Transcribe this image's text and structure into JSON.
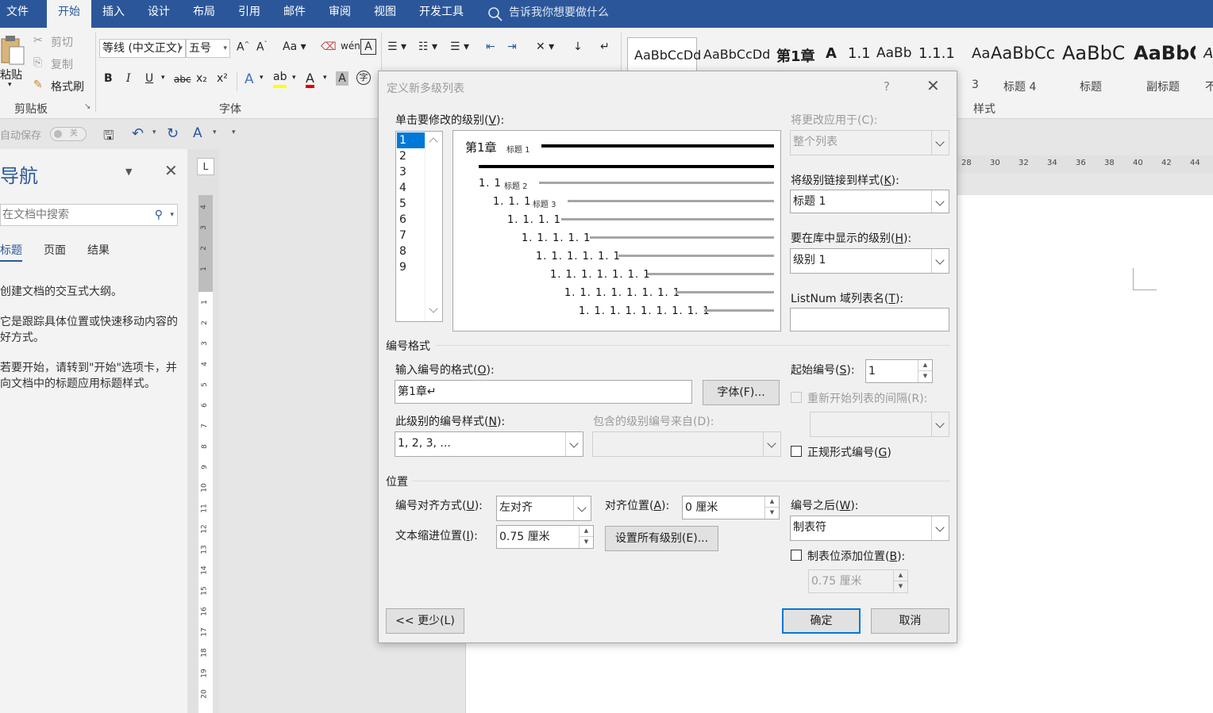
{
  "menubar": {
    "tabs": [
      "文件",
      "开始",
      "插入",
      "设计",
      "布局",
      "引用",
      "邮件",
      "审阅",
      "视图",
      "开发工具"
    ],
    "active": "开始",
    "tell_me": "告诉我你想要做什么"
  },
  "ribbon": {
    "clipboard": {
      "paste": "粘贴",
      "cut": "剪切",
      "copy": "复制",
      "format_painter": "格式刷",
      "group_label": "剪贴板"
    },
    "font": {
      "font_name": "等线 (中文正文)",
      "font_size": "五号",
      "group_label": "字体",
      "bold": "B",
      "italic": "I",
      "underline": "U",
      "strike": "abc",
      "subscript": "x₂",
      "superscript": "x²",
      "change_case": "Aa"
    },
    "styles": {
      "group_label": "样式",
      "tiles": [
        {
          "sample": "AaBbCcDd",
          "name": ""
        },
        {
          "sample": "AaBbCcDd",
          "name": ""
        },
        {
          "sample": "第1章",
          "name": ""
        },
        {
          "sample": "A",
          "name": ""
        },
        {
          "sample": "1.1",
          "name": ""
        },
        {
          "sample": "AaBb",
          "name": ""
        },
        {
          "sample": "1.1.1",
          "name": ""
        },
        {
          "sample": "Aa",
          "name": "3"
        },
        {
          "sample": "AaBbCc",
          "name": "标题 4"
        },
        {
          "sample": "AaBbC",
          "name": "标题"
        },
        {
          "sample": "AaBbC",
          "name": "副标题"
        },
        {
          "sample": "A",
          "name": "不"
        }
      ]
    }
  },
  "qat": {
    "autosave": "自动保存",
    "autosave_state": "关"
  },
  "nav": {
    "title": "导航",
    "search_placeholder": "在文档中搜索",
    "tabs": [
      "标题",
      "页面",
      "结果"
    ],
    "paragraphs": [
      "创建文档的交互式大纲。",
      "它是跟踪具体位置或快速移动内容的好方式。",
      "若要开始，请转到\"开始\"选项卡，并向文档中的标题应用标题样式。"
    ]
  },
  "ruler": {
    "corner": "L",
    "h_labels": [
      "28",
      "30",
      "32",
      "34",
      "36",
      "38",
      "40",
      "42",
      "44"
    ],
    "v_top_labels": [
      "4",
      "3",
      "2",
      "1"
    ],
    "v_labels": [
      "1",
      "2",
      "3",
      "4",
      "5",
      "6",
      "7",
      "8",
      "9",
      "10",
      "11",
      "12",
      "13",
      "14",
      "15",
      "16",
      "17",
      "18",
      "19",
      "20"
    ]
  },
  "dialog": {
    "title": "定义新多级列表",
    "help": "?",
    "close": "✕",
    "level_label": "单击要修改的级别(",
    "level_label_key": "V",
    "level_label_end": "):",
    "levels": [
      "1",
      "2",
      "3",
      "4",
      "5",
      "6",
      "7",
      "8",
      "9"
    ],
    "selected_level": "1",
    "preview": [
      {
        "text": "第1章",
        "tag": "标题 1"
      },
      {
        "text": "",
        "tag": ""
      },
      {
        "text": "1. 1",
        "tag": "标题 2"
      },
      {
        "text": "1. 1. 1",
        "tag": "标题 3"
      },
      {
        "text": "1. 1. 1. 1",
        "tag": ""
      },
      {
        "text": "1. 1. 1. 1. 1",
        "tag": ""
      },
      {
        "text": "1. 1. 1. 1. 1. 1",
        "tag": ""
      },
      {
        "text": "1. 1. 1. 1. 1. 1. 1",
        "tag": ""
      },
      {
        "text": "1. 1. 1. 1. 1. 1. 1. 1",
        "tag": ""
      },
      {
        "text": "1. 1. 1. 1. 1. 1. 1. 1. 1",
        "tag": ""
      }
    ],
    "apply_to_label": "将更改应用于(C):",
    "apply_to_value": "整个列表",
    "link_style_label": "将级别链接到样式(",
    "link_style_key": "K",
    "link_style_end": "):",
    "link_style_value": "标题 1",
    "gallery_level_label": "要在库中显示的级别(",
    "gallery_level_key": "H",
    "gallery_level_end": "):",
    "gallery_level_value": "级别 1",
    "listnum_label": "ListNum 域列表名(",
    "listnum_key": "T",
    "listnum_end": "):",
    "listnum_value": "",
    "number_format_section": "编号格式",
    "enter_format_label": "输入编号的格式(",
    "enter_format_key": "O",
    "enter_format_end": "):",
    "enter_format_value": "第1章↵",
    "font_button": "字体(F)...",
    "number_style_label": "此级别的编号样式(",
    "number_style_key": "N",
    "number_style_end": "):",
    "number_style_value": "1, 2, 3, ...",
    "include_level_label": "包含的级别编号来自(D):",
    "include_level_value": "",
    "start_at_label": "起始编号(",
    "start_at_key": "S",
    "start_at_end": "):",
    "start_at_value": "1",
    "restart_label": "重新开始列表的间隔(R):",
    "restart_value": "",
    "legal_label": "正规形式编号(",
    "legal_key": "G",
    "legal_end": ")",
    "position_section": "位置",
    "alignment_label": "编号对齐方式(",
    "alignment_key": "U",
    "alignment_end": "):",
    "alignment_value": "左对齐",
    "aligned_at_label": "对齐位置(",
    "aligned_at_key": "A",
    "aligned_at_end": "):",
    "aligned_at_value": "0 厘米",
    "follow_label": "编号之后(",
    "follow_key": "W",
    "follow_end": "):",
    "follow_value": "制表符",
    "indent_label": "文本缩进位置(",
    "indent_key": "I",
    "indent_end": "):",
    "indent_value": "0.75 厘米",
    "set_all_button": "设置所有级别(E)...",
    "tab_stop_label": "制表位添加位置(",
    "tab_stop_key": "B",
    "tab_stop_end": "):",
    "tab_stop_value": "0.75 厘米",
    "less_button": "<< 更少(L)",
    "ok_button": "确定",
    "cancel_button": "取消"
  }
}
